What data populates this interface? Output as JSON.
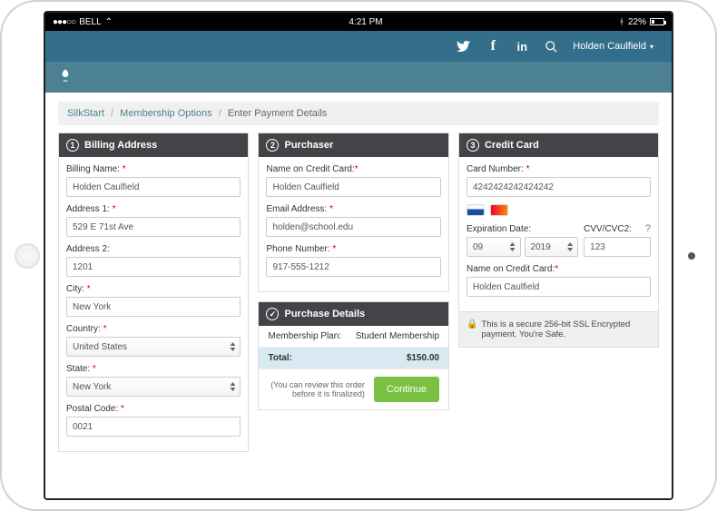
{
  "statusbar": {
    "carrier": "BELL",
    "time": "4:21 PM",
    "battery": "22%"
  },
  "header": {
    "user": "Holden Caulfield"
  },
  "breadcrumb": {
    "a": "SilkStart",
    "b": "Membership Options",
    "c": "Enter Payment Details"
  },
  "billing": {
    "title": "Billing Address",
    "num": "1",
    "name_label": "Billing Name:",
    "name": "Holden Caulfield",
    "addr1_label": "Address 1:",
    "addr1": "529 E 71st Ave",
    "addr2_label": "Address 2:",
    "addr2": "1201",
    "city_label": "City:",
    "city": "New York",
    "country_label": "Country:",
    "country": "United States",
    "state_label": "State:",
    "state": "New York",
    "postal_label": "Postal Code:",
    "postal": "0021"
  },
  "purchaser": {
    "title": "Purchaser",
    "num": "2",
    "name_label": "Name on Credit Card:",
    "name": "Holden Caulfield",
    "email_label": "Email Address:",
    "email": "holden@school.edu",
    "phone_label": "Phone Number:",
    "phone": "917-555-1212"
  },
  "card": {
    "title": "Credit Card",
    "num": "3",
    "number_label": "Card Number:",
    "number": "4242424242424242",
    "exp_label": "Expiration Date:",
    "exp_m": "09",
    "exp_y": "2019",
    "cvv_label": "CVV/CVC2:",
    "cvv": "123",
    "name_label": "Name on Credit Card:",
    "name": "Holden Caulfield",
    "secure": "This is a secure 256-bit SSL Encrypted payment. You're Safe."
  },
  "purchase": {
    "title": "Purchase Details",
    "plan_label": "Membership Plan:",
    "plan": "Student Membership",
    "total_label": "Total:",
    "total": "$150.00",
    "review": "(You can review this order before it is finalized)",
    "continue": "Continue"
  },
  "req": "*"
}
